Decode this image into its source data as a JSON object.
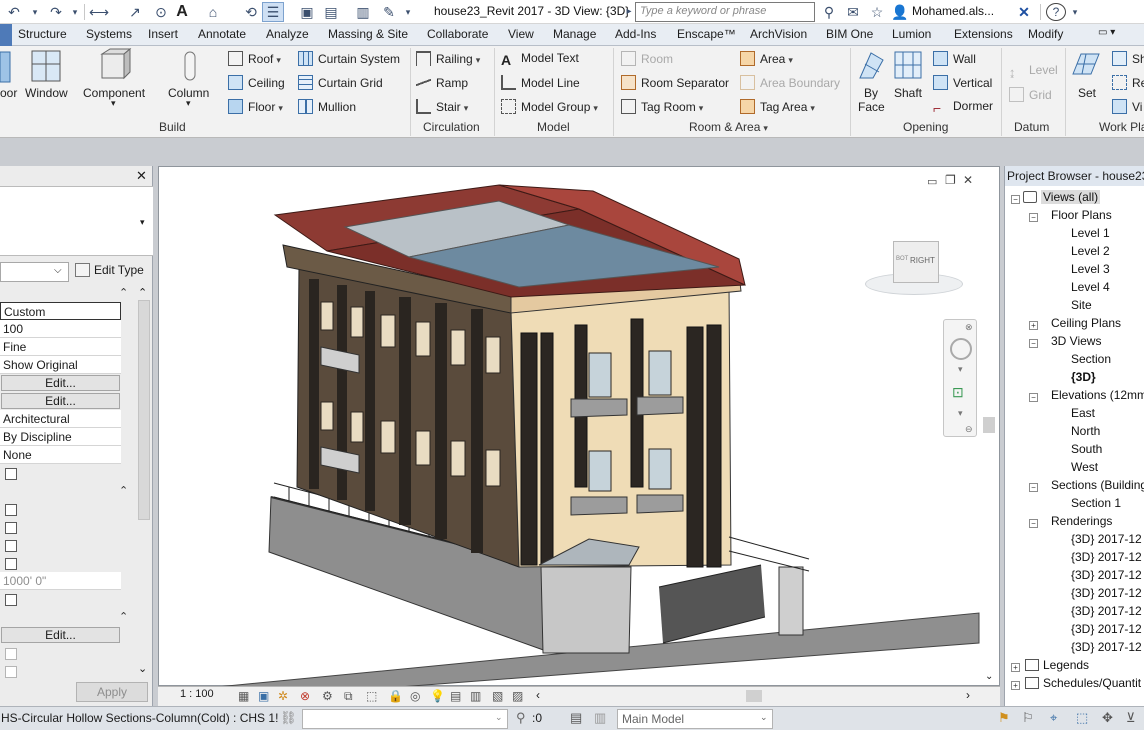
{
  "titlebar": {
    "title": "house23_Revit 2017 - 3D View: {3D}",
    "search_placeholder": "Type a keyword or phrase",
    "user": "Mohamed.als...",
    "help": "?"
  },
  "tabs": [
    "Structure",
    "Systems",
    "Insert",
    "Annotate",
    "Analyze",
    "Massing & Site",
    "Collaborate",
    "View",
    "Manage",
    "Add-Ins",
    "Enscape™",
    "ArchVision",
    "BIM One",
    "Lumion",
    "Extensions",
    "Modify"
  ],
  "ribbon": {
    "build": {
      "door": "oor",
      "window": "Window",
      "component": "Component",
      "column": "Column",
      "roof": "Roof",
      "ceiling": "Ceiling",
      "floor": "Floor",
      "curtain_system": "Curtain System",
      "curtain_grid": "Curtain Grid",
      "mullion": "Mullion",
      "label": "Build"
    },
    "circulation": {
      "railing": "Railing",
      "ramp": "Ramp",
      "stair": "Stair",
      "label": "Circulation"
    },
    "model": {
      "model_text": "Model Text",
      "model_line": "Model Line",
      "model_group": "Model Group",
      "label": "Model"
    },
    "room_area": {
      "room": "Room",
      "room_separator": "Room Separator",
      "tag_room": "Tag Room",
      "area": "Area",
      "area_boundary": "Area Boundary",
      "tag_area": "Tag Area",
      "label": "Room & Area"
    },
    "opening": {
      "by_face_1": "By",
      "by_face_2": "Face",
      "shaft": "Shaft",
      "wall": "Wall",
      "vertical": "Vertical",
      "dormer": "Dormer",
      "label": "Opening"
    },
    "datum": {
      "level": "Level",
      "grid": "Grid",
      "label": "Datum"
    },
    "work_plane": {
      "set": "Set",
      "show": "Sh",
      "ref": "Re",
      "viewer": "Vi",
      "label": "Work Pla"
    }
  },
  "properties": {
    "edit_type": "Edit Type",
    "values": [
      "Custom",
      "100",
      "Fine",
      "Show Original"
    ],
    "edit_label": "Edit...",
    "values2": [
      "Architectural",
      "By Discipline",
      "None"
    ],
    "far_clip": "1000' 0\"",
    "apply": "Apply"
  },
  "view": {
    "scale": "1 : 100",
    "viewcube_label": "RIGHT",
    "viewcube_side": "BOT"
  },
  "browser": {
    "title": "Project Browser - house23_",
    "views_all": "Views (all)",
    "floor_plans": "Floor Plans",
    "levels": [
      "Level 1",
      "Level 2",
      "Level 3",
      "Level 4",
      "Site"
    ],
    "ceiling_plans": "Ceiling Plans",
    "views_3d": "3D Views",
    "views_3d_items": [
      "Section",
      "{3D}"
    ],
    "elevations": "Elevations (12mm",
    "elevation_items": [
      "East",
      "North",
      "South",
      "West"
    ],
    "sections": "Sections (Building",
    "section_items": [
      "Section 1"
    ],
    "renderings": "Renderings",
    "rendering_items": [
      "{3D} 2017-12",
      "{3D} 2017-12",
      "{3D} 2017-12",
      "{3D} 2017-12",
      "{3D} 2017-12",
      "{3D} 2017-12",
      "{3D} 2017-12"
    ],
    "legends": "Legends",
    "schedules": "Schedules/Quantit"
  },
  "status": {
    "text": "HS-Circular Hollow Sections-Column(Cold) : CHS 1!",
    "count": ":0",
    "model": "Main Model"
  }
}
